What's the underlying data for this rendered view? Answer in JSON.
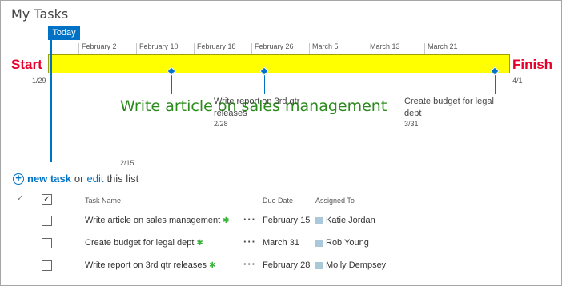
{
  "page": {
    "title": "My Tasks"
  },
  "timeline": {
    "today_label": "Today",
    "start_label": "Start",
    "finish_label": "Finish",
    "start_date": "1/29",
    "finish_date": "4/1",
    "bar_color": "#ffff00",
    "date_scale": [
      "February 2",
      "February 10",
      "February 18",
      "February 26",
      "March 5",
      "March 13",
      "March 21"
    ],
    "callouts": [
      {
        "text": "Write article on sales management",
        "date": "2/15"
      },
      {
        "text": "Write report on 3rd qtr releases",
        "date": "2/28"
      },
      {
        "text": "Create budget for legal dept",
        "date": "3/31"
      }
    ]
  },
  "actions": {
    "new_task_label": "new task",
    "or_text": "or",
    "edit_label": "edit",
    "this_list_text": "this list"
  },
  "list": {
    "columns": {
      "task_name": "Task Name",
      "due_date": "Due Date",
      "assigned_to": "Assigned To"
    },
    "rows": [
      {
        "title": "Write article on sales management",
        "due": "February 15",
        "assigned": "Katie Jordan"
      },
      {
        "title": "Create budget for legal dept",
        "due": "March 31",
        "assigned": "Rob Young"
      },
      {
        "title": "Write report on 3rd qtr releases",
        "due": "February 28",
        "assigned": "Molly Dempsey"
      }
    ]
  },
  "colors": {
    "accent": "#0072c6",
    "start_finish": "#e8002b",
    "highlight_callout": "#2a8a1b"
  },
  "icons": {
    "row_menu": "ellipsis-icon",
    "new_item": "star-icon",
    "add": "plus-circle-icon"
  }
}
